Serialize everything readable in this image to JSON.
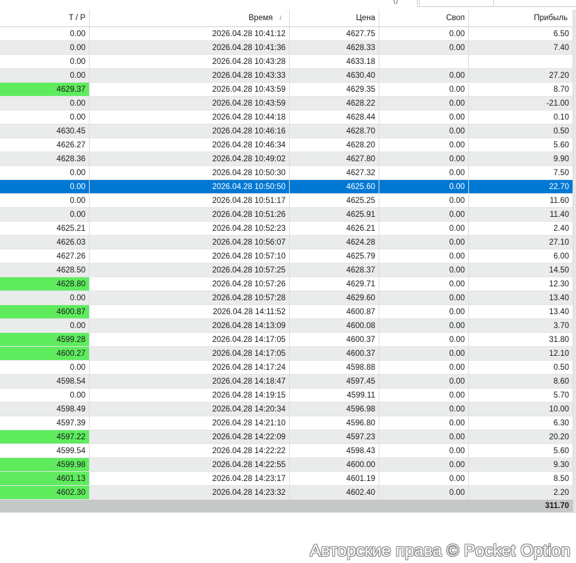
{
  "columns": {
    "tp": "T / P",
    "time": "Время",
    "time_sort_indicator": "/",
    "price": "Цена",
    "swap": "Своп",
    "profit": "Прибыль"
  },
  "rows": [
    {
      "tp": "0.00",
      "time": "2026.04.28 10:41:12",
      "price": "4627.75",
      "swap": "0.00",
      "profit": "6.50",
      "tp_hit": false
    },
    {
      "tp": "0.00",
      "time": "2026.04.28 10:41:36",
      "price": "4628.33",
      "swap": "0.00",
      "profit": "7.40",
      "tp_hit": false
    },
    {
      "tp": "0.00",
      "time": "2026.04.28 10:43:28",
      "price": "4633.18",
      "swap": "",
      "profit": "",
      "tp_hit": false
    },
    {
      "tp": "0.00",
      "time": "2026.04.28 10:43:33",
      "price": "4630.40",
      "swap": "0.00",
      "profit": "27.20",
      "tp_hit": false
    },
    {
      "tp": "4629.37",
      "time": "2026.04.28 10:43:59",
      "price": "4629.35",
      "swap": "0.00",
      "profit": "8.70",
      "tp_hit": true
    },
    {
      "tp": "0.00",
      "time": "2026.04.28 10:43:59",
      "price": "4628.22",
      "swap": "0.00",
      "profit": "-21.00",
      "tp_hit": false
    },
    {
      "tp": "0.00",
      "time": "2026.04.28 10:44:18",
      "price": "4628.44",
      "swap": "0.00",
      "profit": "0.10",
      "tp_hit": false
    },
    {
      "tp": "4630.45",
      "time": "2026.04.28 10:46:16",
      "price": "4628.70",
      "swap": "0.00",
      "profit": "0.50",
      "tp_hit": false
    },
    {
      "tp": "4626.27",
      "time": "2026.04.28 10:46:34",
      "price": "4628.20",
      "swap": "0.00",
      "profit": "5.60",
      "tp_hit": false
    },
    {
      "tp": "4628.36",
      "time": "2026.04.28 10:49:02",
      "price": "4627.80",
      "swap": "0.00",
      "profit": "9.90",
      "tp_hit": false
    },
    {
      "tp": "0.00",
      "time": "2026.04.28 10:50:30",
      "price": "4627.32",
      "swap": "0.00",
      "profit": "7.50",
      "tp_hit": false
    },
    {
      "tp": "0.00",
      "time": "2026.04.28 10:50:50",
      "price": "4625.60",
      "swap": "0.00",
      "profit": "22.70",
      "tp_hit": false,
      "selected": true
    },
    {
      "tp": "0.00",
      "time": "2026.04.28 10:51:17",
      "price": "4625.25",
      "swap": "0.00",
      "profit": "11.60",
      "tp_hit": false
    },
    {
      "tp": "0.00",
      "time": "2026.04.28 10:51:26",
      "price": "4625.91",
      "swap": "0.00",
      "profit": "11.40",
      "tp_hit": false
    },
    {
      "tp": "4625.21",
      "time": "2026.04.28 10:52:23",
      "price": "4626.21",
      "swap": "0.00",
      "profit": "2.40",
      "tp_hit": false
    },
    {
      "tp": "4626.03",
      "time": "2026.04.28 10:56:07",
      "price": "4624.28",
      "swap": "0.00",
      "profit": "27.10",
      "tp_hit": false
    },
    {
      "tp": "4627.26",
      "time": "2026.04.28 10:57:10",
      "price": "4625.79",
      "swap": "0.00",
      "profit": "6.00",
      "tp_hit": false
    },
    {
      "tp": "4628.50",
      "time": "2026.04.28 10:57:25",
      "price": "4628.37",
      "swap": "0.00",
      "profit": "14.50",
      "tp_hit": false
    },
    {
      "tp": "4628.80",
      "time": "2026.04.28 10:57:26",
      "price": "4629.71",
      "swap": "0.00",
      "profit": "12.30",
      "tp_hit": true
    },
    {
      "tp": "0.00",
      "time": "2026.04.28 10:57:28",
      "price": "4629.60",
      "swap": "0.00",
      "profit": "13.40",
      "tp_hit": false
    },
    {
      "tp": "4600.87",
      "time": "2026.04.28 14:11:52",
      "price": "4600.87",
      "swap": "0.00",
      "profit": "13.40",
      "tp_hit": true
    },
    {
      "tp": "0.00",
      "time": "2026.04.28 14:13:09",
      "price": "4600.08",
      "swap": "0.00",
      "profit": "3.70",
      "tp_hit": false
    },
    {
      "tp": "4599.28",
      "time": "2026.04.28 14:17:05",
      "price": "4600.37",
      "swap": "0.00",
      "profit": "31.80",
      "tp_hit": true
    },
    {
      "tp": "4600.27",
      "time": "2026.04.28 14:17:05",
      "price": "4600.37",
      "swap": "0.00",
      "profit": "12.10",
      "tp_hit": true
    },
    {
      "tp": "0.00",
      "time": "2026.04.28 14:17:24",
      "price": "4598.88",
      "swap": "0.00",
      "profit": "0.50",
      "tp_hit": false
    },
    {
      "tp": "4598.54",
      "time": "2026.04.28 14:18:47",
      "price": "4597.45",
      "swap": "0.00",
      "profit": "8.60",
      "tp_hit": false
    },
    {
      "tp": "0.00",
      "time": "2026.04.28 14:19:15",
      "price": "4599.11",
      "swap": "0.00",
      "profit": "5.70",
      "tp_hit": false
    },
    {
      "tp": "4598.49",
      "time": "2026.04.28 14:20:34",
      "price": "4596.98",
      "swap": "0.00",
      "profit": "10.00",
      "tp_hit": false
    },
    {
      "tp": "4597.39",
      "time": "2026.04.28 14:21:10",
      "price": "4596.80",
      "swap": "0.00",
      "profit": "6.30",
      "tp_hit": false
    },
    {
      "tp": "4597.22",
      "time": "2026.04.28 14:22:09",
      "price": "4597.23",
      "swap": "0.00",
      "profit": "20.20",
      "tp_hit": true
    },
    {
      "tp": "4599.54",
      "time": "2026.04.28 14:22:22",
      "price": "4598.43",
      "swap": "0.00",
      "profit": "5.60",
      "tp_hit": false
    },
    {
      "tp": "4599.98",
      "time": "2026.04.28 14:22:55",
      "price": "4600.00",
      "swap": "0.00",
      "profit": "9.30",
      "tp_hit": true
    },
    {
      "tp": "4601.13",
      "time": "2026.04.28 14:23:17",
      "price": "4601.19",
      "swap": "0.00",
      "profit": "8.50",
      "tp_hit": true
    },
    {
      "tp": "4602.30",
      "time": "2026.04.28 14:23:32",
      "price": "4602.40",
      "swap": "0.00",
      "profit": "2.20",
      "tp_hit": true
    }
  ],
  "total_profit": "311.70",
  "watermark": "Авторские права © Pocket Option",
  "colors": {
    "tp_hit": "#5eec5e",
    "selected_row": "#0078d4",
    "zebra_row": "#e9ecea",
    "total_row": "#c6c8c7"
  }
}
